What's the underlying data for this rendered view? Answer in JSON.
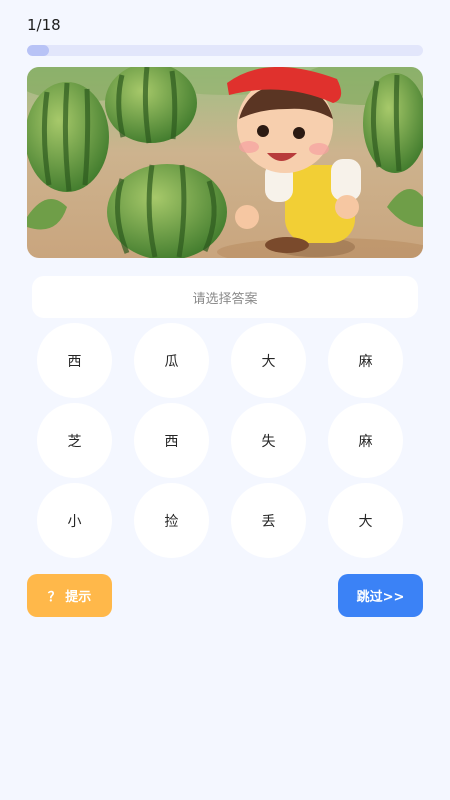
{
  "header": {
    "counter": "1/18",
    "progress": 0.0556
  },
  "answer": {
    "placeholder": "请选择答案"
  },
  "choices": [
    "西",
    "瓜",
    "大",
    "麻",
    "芝",
    "西",
    "失",
    "麻",
    "小",
    "捡",
    "丢",
    "大"
  ],
  "actions": {
    "hint_label": "？ 提示",
    "skip_label": "跳过>>"
  },
  "colors": {
    "background": "#f4f7ff",
    "hint": "#ffb84a",
    "skip": "#3b82f6",
    "progress_track": "#e2e6fb"
  }
}
